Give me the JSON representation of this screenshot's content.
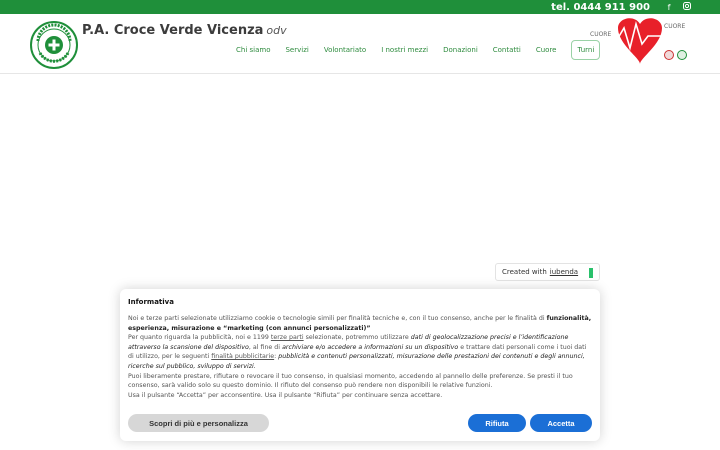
{
  "topbar": {
    "phone": "tel. 0444 911 900",
    "social": [
      "facebook-icon",
      "instagram-icon"
    ]
  },
  "header": {
    "brand_name": "P.A. Croce Verde Vicenza",
    "brand_suffix": "odv",
    "nav": [
      "Chi siamo",
      "Servizi",
      "Volontariato",
      "I nostri mezzi",
      "Donazioni",
      "Contatti",
      "Cuore",
      "Turni"
    ],
    "banner_words": [
      "CUORE",
      "CUORE"
    ]
  },
  "iubenda": {
    "created_with": "Created with",
    "brand": "iubenda"
  },
  "consent": {
    "title": "Informativa",
    "p1_a": "Noi e terze parti selezionate utilizziamo cookie o tecnologie simili per finalità tecniche e, con il tuo consenso, anche per le finalità di ",
    "p1_b": "funzionalità, esperienza, misurazione e “marketing (con annunci personalizzati)”",
    "p2_a": "Per quanto riguarda la pubblicità, noi e 1199 ",
    "p2_link": "terze parti",
    "p2_b": " selezionate, potremmo utilizzare ",
    "p2_c": "dati di geolocalizzazione precisi e l’identificazione attraverso la scansione del dispositivo",
    "p2_d": ", al fine di ",
    "p2_e": "archiviare e/o accedere a informazioni su un dispositivo",
    "p2_f": " e trattare dati personali come i tuoi dati di utilizzo, per le seguenti ",
    "p2_link2": "finalità pubblicitarie",
    "p2_g": ": ",
    "p2_h": "pubblicità e contenuti personalizzati, misurazione delle prestazioni dei contenuti e degli annunci, ricerche sul pubblico, sviluppo di servizi.",
    "p3": "Puoi liberamente prestare, rifiutare o revocare il tuo consenso, in qualsiasi momento, accedendo al pannello delle preferenze. Se presti il tuo consenso, sarà valido solo su questo dominio. Il rifiuto del consenso può rendere non disponibili le relative funzioni.",
    "p4": "Usa il pulsante “Accetta” per acconsentire. Usa il pulsante “Rifiuta” per continuare senza accettare.",
    "btn_more": "Scopri di più e personalizza",
    "btn_reject": "Rifiuta",
    "btn_accept": "Accetta"
  },
  "colors": {
    "brand_green": "#1f8f3a",
    "primary_blue": "#1b6fd6",
    "heart_red": "#e8202a"
  }
}
